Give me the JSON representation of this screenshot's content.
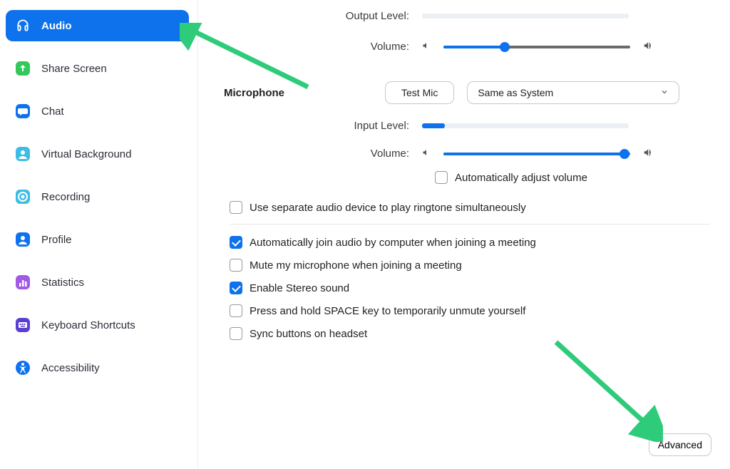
{
  "sidebar": {
    "items": [
      {
        "label": "Audio"
      },
      {
        "label": "Share Screen"
      },
      {
        "label": "Chat"
      },
      {
        "label": "Virtual Background"
      },
      {
        "label": "Recording"
      },
      {
        "label": "Profile"
      },
      {
        "label": "Statistics"
      },
      {
        "label": "Keyboard Shortcuts"
      },
      {
        "label": "Accessibility"
      }
    ]
  },
  "main": {
    "output_level_label": "Output Level:",
    "volume_label": "Volume:",
    "microphone_label": "Microphone",
    "test_mic_label": "Test Mic",
    "mic_select_value": "Same as System",
    "input_level_label": "Input Level:",
    "auto_adjust_label": "Automatically adjust volume",
    "separate_device_label": "Use separate audio device to play ringtone simultaneously",
    "auto_join_label": "Automatically join audio by computer when joining a meeting",
    "mute_mic_label": "Mute my microphone when joining a meeting",
    "stereo_label": "Enable Stereo sound",
    "space_unmute_label": "Press and hold SPACE key to temporarily unmute yourself",
    "sync_headset_label": "Sync buttons on headset",
    "advanced_label": "Advanced",
    "output_volume_percent": 33,
    "mic_volume_percent": 97,
    "input_level_percent": 11
  }
}
